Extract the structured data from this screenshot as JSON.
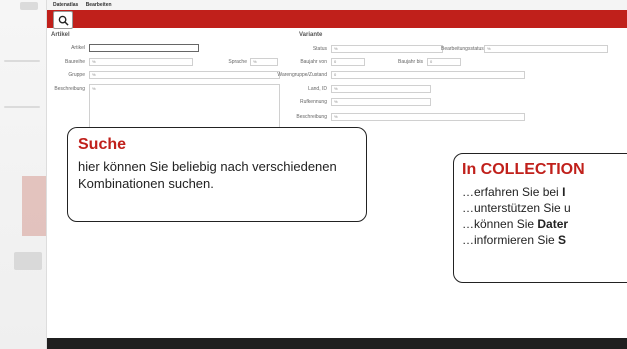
{
  "menu": {
    "item1": "Datenatlas",
    "item2": "Bearbeiten"
  },
  "left_panel": {
    "title": "Artikel",
    "fields": [
      {
        "label": "Artikel",
        "value": ""
      },
      {
        "label": "Baureihe",
        "value": "%"
      },
      {
        "label": "Gruppe",
        "value": "%"
      },
      {
        "label": "Beschreibung",
        "value": "%"
      }
    ],
    "extra_label": "Sprache",
    "extra_value": "%"
  },
  "right_panel": {
    "title": "Variante",
    "fields": [
      {
        "label": "Status",
        "value": "%"
      },
      {
        "label": "Baujahr von",
        "value": "0"
      },
      {
        "label": "Warengruppe/Zustand",
        "value": "0"
      },
      {
        "label": "Land, ID",
        "value": "%"
      },
      {
        "label": "Rufkennung",
        "value": "%"
      },
      {
        "label": "Beschreibung",
        "value": "%"
      }
    ],
    "extra1_label": "Bearbeitungsstatus",
    "extra1_value": "%",
    "extra2_label": "Baujahr bis",
    "extra2_value": "0"
  },
  "callout_search": {
    "heading": "Suche",
    "text": "hier können Sie beliebig nach verschiedenen Kombinationen suchen."
  },
  "callout_collection": {
    "heading": "In COLLECTION",
    "lines": [
      {
        "pre": "…erfahren Sie bei ",
        "bold": "I"
      },
      {
        "pre": "…unterstützen Sie u",
        "bold": ""
      },
      {
        "pre": "…können Sie ",
        "bold": "Dater"
      },
      {
        "pre": "…informieren Sie ",
        "bold": "S"
      }
    ]
  },
  "colors": {
    "accent": "#c0201b",
    "footer": "#1f1f1f"
  }
}
